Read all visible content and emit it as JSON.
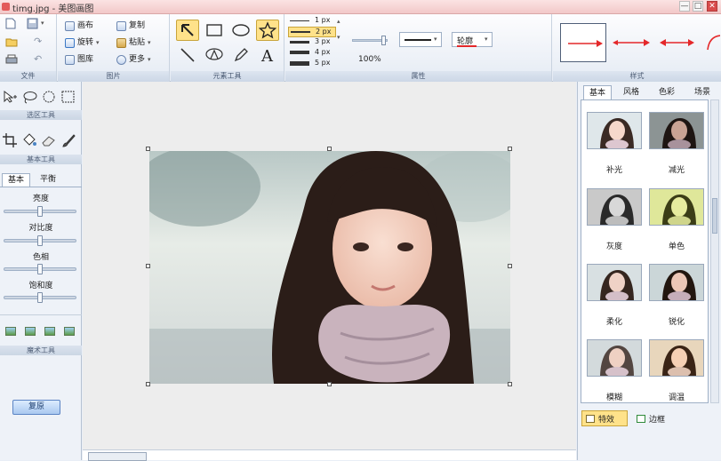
{
  "window": {
    "title": "timg.jpg - 美图画图",
    "min": "—",
    "max": "□",
    "close": "✕"
  },
  "ribbon": {
    "file": {
      "label": "文件",
      "new": "新建",
      "save": "保存",
      "open": "打开",
      "print": "打印"
    },
    "image": {
      "label": "图片",
      "canvas": "画布",
      "copy": "复制",
      "rotate": "旋转",
      "paste": "粘贴",
      "gallery": "图库",
      "more": "更多"
    },
    "shape_tools": {
      "label": "元素工具",
      "tool_names": [
        "arrow",
        "rectangle",
        "ellipse",
        "star",
        "line",
        "stamp",
        "pen",
        "text"
      ]
    },
    "properties": {
      "label": "属性",
      "widths": [
        "1 px",
        "2 px",
        "3 px",
        "4 px",
        "5 px"
      ],
      "selected_width": "2 px",
      "opacity": "100%",
      "outline_label": "轮廓"
    },
    "styles": {
      "label": "样式"
    }
  },
  "left_panel": {
    "select_label": "选区工具",
    "basic_label": "基本工具",
    "tabs": [
      "基本",
      "平衡"
    ],
    "sliders": [
      {
        "label": "亮度",
        "value": 0.5
      },
      {
        "label": "对比度",
        "value": 0.5
      },
      {
        "label": "色相",
        "value": 0.5
      },
      {
        "label": "饱和度",
        "value": 0.5
      }
    ],
    "magic_label": "魔术工具",
    "reset_button": "复原"
  },
  "right_panel": {
    "tabs": [
      "基本",
      "风格",
      "色彩",
      "场景"
    ],
    "effects": [
      "补光",
      "减光",
      "灰度",
      "单色",
      "柔化",
      "锐化",
      "模糊",
      "调温"
    ],
    "bottom_tabs": [
      "特效",
      "边框"
    ]
  },
  "colors": {
    "accent": "#e4282a",
    "selection": "#ffe28a",
    "panel": "#eef2f8"
  }
}
